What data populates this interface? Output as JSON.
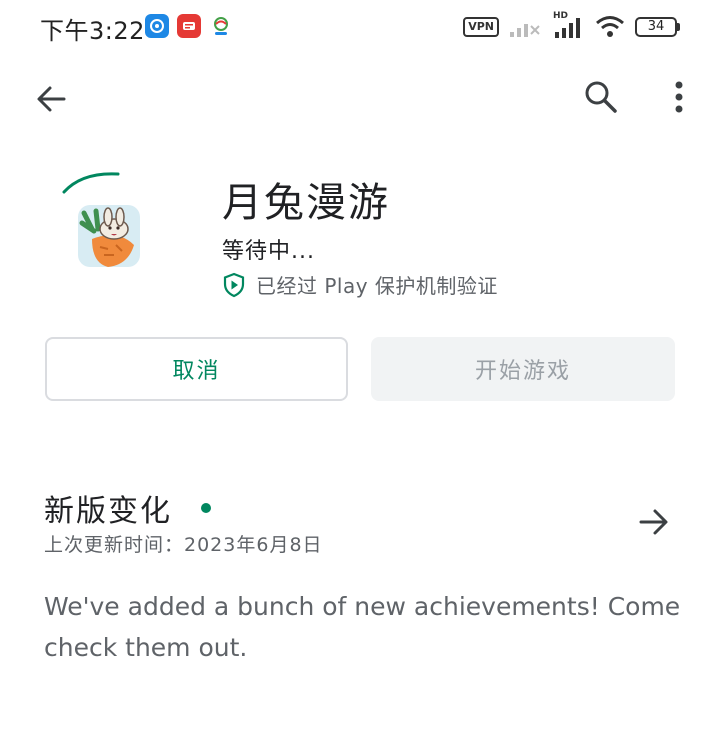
{
  "status_bar": {
    "time": "下午3:22",
    "vpn_label": "VPN",
    "hd_label": "HD",
    "battery": "34",
    "notification_icons": [
      "weibo-app-icon",
      "news-app-icon",
      "mobile-app-icon"
    ]
  },
  "app_bar": {
    "back_icon": "arrow-left-icon",
    "search_icon": "search-icon",
    "more_icon": "more-vert-icon"
  },
  "app": {
    "title": "月兔漫游",
    "status": "等待中...",
    "verified_text": "已经过 Play 保护机制验证",
    "progress_color": "#01875f"
  },
  "actions": {
    "cancel_label": "取消",
    "play_label": "开始游戏"
  },
  "whats_new": {
    "title": "新版变化",
    "updated": "上次更新时间：2023年6月8日",
    "body": "We've added a bunch of new achievements! Come check them out."
  },
  "colors": {
    "accent": "#01875f",
    "disabled_bg": "#f1f3f4",
    "secondary_text": "#5f6368"
  }
}
